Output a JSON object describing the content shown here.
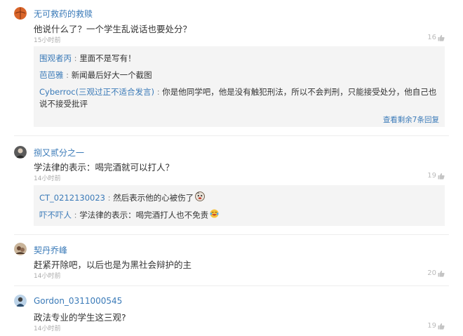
{
  "comments": [
    {
      "name": "无可救药的救赎",
      "text": "他说什么了？一个学生乱说话也要处分？",
      "time": "15小时前",
      "likes": "16",
      "replies": [
        {
          "name": "围观者丙",
          "sep": " : ",
          "text": "里面不是写有！"
        },
        {
          "name": "芭芭雅",
          "sep": " : ",
          "text": "新闻最后好大一个截图"
        },
        {
          "name": "Cyberroc(三观过正不适合发言)",
          "sep": " : ",
          "text": "你是他同学吧，他是没有触犯刑法，所以不会判刑，只能接受处分，他自己也说不接受批评"
        }
      ],
      "more": "查看剩余7条回复"
    },
    {
      "name": "捌又贰分之一",
      "text": "学法律的表示：喝完酒就可以打人？",
      "time": "14小时前",
      "likes": "19",
      "replies": [
        {
          "name": "CT_0212130023",
          "sep": " : ",
          "text": "然后表示他的心被伤了"
        },
        {
          "name": "吓不吓人",
          "sep": " : ",
          "text": "学法律的表示：喝完酒打人也不免责"
        }
      ]
    },
    {
      "name": "契丹乔峰",
      "text": "赶紧开除吧，以后也是为黑社会辩护的主",
      "time": "14小时前",
      "likes": "20"
    },
    {
      "name": "Gordon_0311000545",
      "text": "政法专业的学生这三观?",
      "time": "14小时前",
      "likes": "19"
    }
  ],
  "icons": {
    "like": "thumbs-up-icon",
    "emoji_broken_heart": "crying-face-emoji",
    "emoji_laugh": "laughing-face-emoji"
  },
  "colors": {
    "link": "#3a7ab8",
    "reply_bg": "#f4f4f4",
    "meta": "#aaaaaa"
  }
}
